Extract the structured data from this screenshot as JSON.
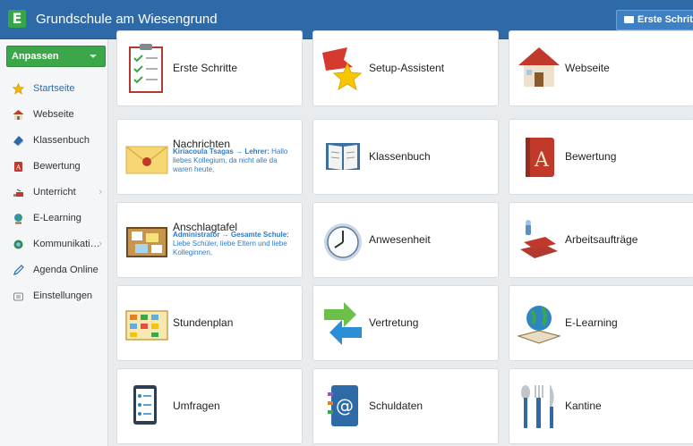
{
  "header": {
    "title": "Grundschule am Wiesengrund",
    "logo_letter": "E",
    "button_label": "Erste Schritte"
  },
  "sidebar": {
    "anpassen_label": "Anpassen",
    "items": [
      {
        "label": "Startseite",
        "icon": "star-icon",
        "active": true
      },
      {
        "label": "Webseite",
        "icon": "house-icon"
      },
      {
        "label": "Klassenbuch",
        "icon": "book-icon"
      },
      {
        "label": "Bewertung",
        "icon": "grade-book-icon"
      },
      {
        "label": "Unterricht",
        "icon": "teaching-icon",
        "has_submenu": true
      },
      {
        "label": "E-Learning",
        "icon": "globe-icon"
      },
      {
        "label": "Kommunikati…",
        "icon": "communication-icon",
        "has_submenu": true
      },
      {
        "label": "Agenda Online",
        "icon": "pencil-icon"
      },
      {
        "label": "Einstellungen",
        "icon": "settings-icon"
      }
    ]
  },
  "tiles": [
    {
      "label": "Erste Schritte",
      "icon": "checklist-icon"
    },
    {
      "label": "Setup-Assistent",
      "icon": "star-flag-icon"
    },
    {
      "label": "Webseite",
      "icon": "house-icon"
    },
    {
      "label": "Nachrichten",
      "icon": "envelope-icon",
      "msg_sender": "Kiriacoula Tsagas → Lehrer:",
      "msg_text": "Hallo liebes Kollegium, da nicht alle da waren heute,"
    },
    {
      "label": "Klassenbuch",
      "icon": "open-book-icon"
    },
    {
      "label": "Bewertung",
      "icon": "grade-book-icon"
    },
    {
      "label": "Anschlagtafel",
      "icon": "bulletin-board-icon",
      "msg_sender": "Administrator → Gesamte Schule:",
      "msg_text": "Liebe Schüler, liebe Eltern und liebe Kolleginnen,"
    },
    {
      "label": "Anwesenheit",
      "icon": "clock-icon"
    },
    {
      "label": "Arbeitsaufträge",
      "icon": "books-stack-icon"
    },
    {
      "label": "Stundenplan",
      "icon": "timetable-icon"
    },
    {
      "label": "Vertretung",
      "icon": "swap-arrows-icon"
    },
    {
      "label": "E-Learning",
      "icon": "globe-book-icon"
    },
    {
      "label": "Umfragen",
      "icon": "survey-icon"
    },
    {
      "label": "Schuldaten",
      "icon": "address-book-icon"
    },
    {
      "label": "Kantine",
      "icon": "cutlery-icon"
    }
  ],
  "colors": {
    "header": "#2e6aa8",
    "accent_green": "#3ca64b",
    "link_blue": "#2e7bc4"
  }
}
